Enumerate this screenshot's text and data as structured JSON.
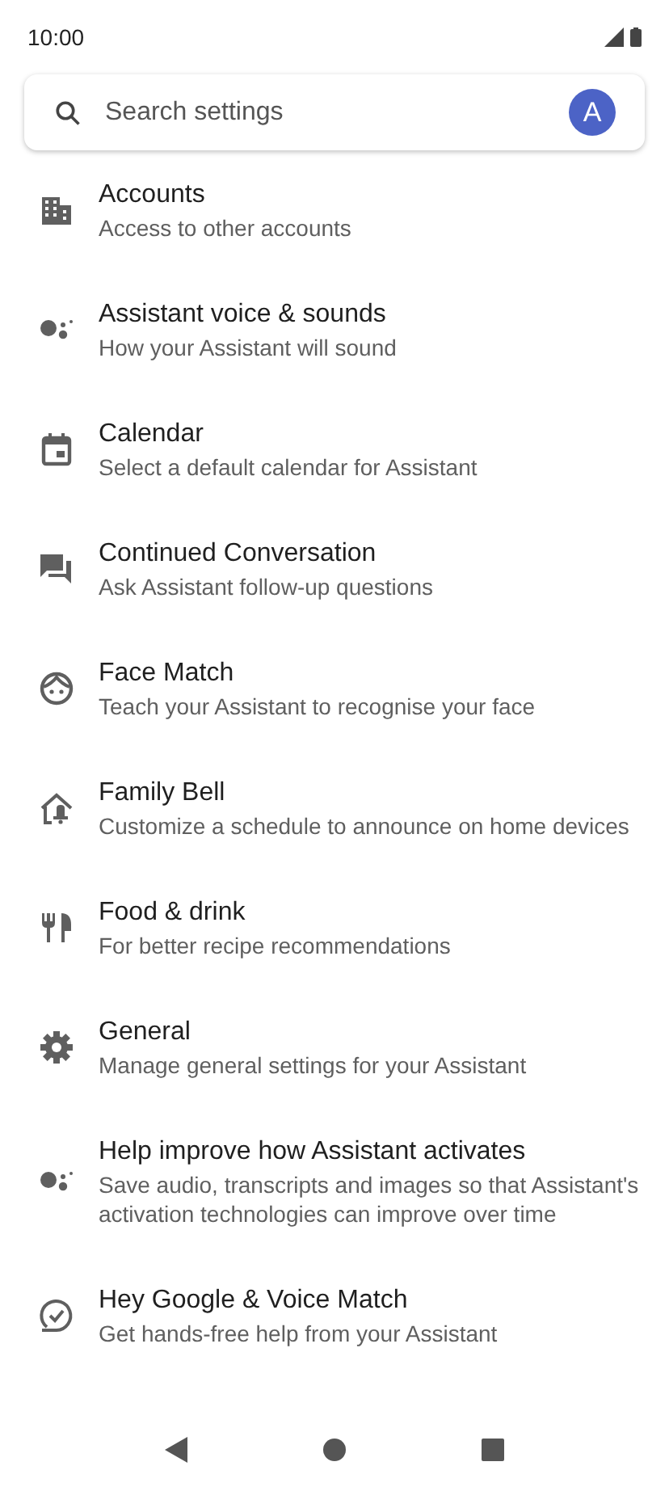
{
  "status_bar": {
    "time": "10:00"
  },
  "search": {
    "placeholder": "Search settings",
    "avatar": "A"
  },
  "items": [
    {
      "kind": "building",
      "title": "Accounts",
      "subtitle": "Access to other accounts"
    },
    {
      "kind": "assistant",
      "title": "Assistant voice & sounds",
      "subtitle": "How your Assistant will sound"
    },
    {
      "kind": "calendar",
      "title": "Calendar",
      "subtitle": "Select a default calendar for Assistant"
    },
    {
      "kind": "chat",
      "title": "Continued Conversation",
      "subtitle": "Ask Assistant follow-up questions"
    },
    {
      "kind": "face",
      "title": "Face Match",
      "subtitle": "Teach your Assistant to recognise your face"
    },
    {
      "kind": "home",
      "title": "Family Bell",
      "subtitle": "Customize a schedule to announce on home devices"
    },
    {
      "kind": "food",
      "title": "Food & drink",
      "subtitle": "For better recipe recommendations"
    },
    {
      "kind": "gear",
      "title": "General",
      "subtitle": "Manage general settings for your Assistant"
    },
    {
      "kind": "assistant",
      "title": "Help improve how Assistant activates",
      "subtitle": "Save audio, transcripts and images so that Assistant's activation technologies can improve over time"
    },
    {
      "kind": "check",
      "title": "Hey Google & Voice Match",
      "subtitle": "Get hands-free help from your Assistant"
    }
  ]
}
